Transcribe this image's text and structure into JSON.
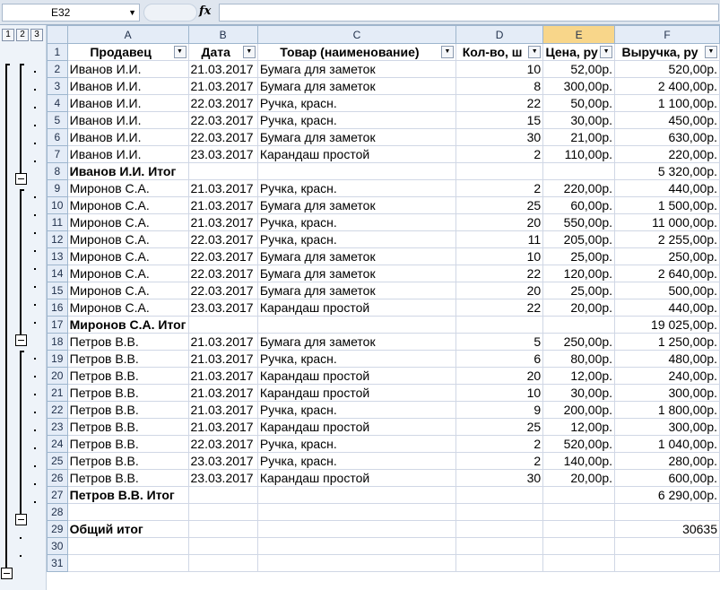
{
  "formula_bar": {
    "name_box": "E32",
    "fx_label": "fx"
  },
  "outline": {
    "levels": [
      "1",
      "2",
      "3"
    ]
  },
  "columns": [
    "A",
    "B",
    "C",
    "D",
    "E",
    "F"
  ],
  "headers": [
    "Продавец",
    "Дата",
    "Товар (наименование)",
    "Кол-во, ш",
    "Цена, ру",
    "Выручка, ру"
  ],
  "rows": [
    {
      "n": "2",
      "a": "Иванов И.И.",
      "b": "21.03.2017",
      "c": "Бумага для заметок",
      "d": "10",
      "e": "52,00р.",
      "f": "520,00р."
    },
    {
      "n": "3",
      "a": "Иванов И.И.",
      "b": "21.03.2017",
      "c": "Бумага для заметок",
      "d": "8",
      "e": "300,00р.",
      "f": "2 400,00р."
    },
    {
      "n": "4",
      "a": "Иванов И.И.",
      "b": "22.03.2017",
      "c": "Ручка, красн.",
      "d": "22",
      "e": "50,00р.",
      "f": "1 100,00р."
    },
    {
      "n": "5",
      "a": "Иванов И.И.",
      "b": "22.03.2017",
      "c": "Ручка, красн.",
      "d": "15",
      "e": "30,00р.",
      "f": "450,00р."
    },
    {
      "n": "6",
      "a": "Иванов И.И.",
      "b": "22.03.2017",
      "c": "Бумага для заметок",
      "d": "30",
      "e": "21,00р.",
      "f": "630,00р."
    },
    {
      "n": "7",
      "a": "Иванов И.И.",
      "b": "23.03.2017",
      "c": "Карандаш простой",
      "d": "2",
      "e": "110,00р.",
      "f": "220,00р."
    },
    {
      "n": "8",
      "a": "Иванов И.И. Итог",
      "b": "",
      "c": "",
      "d": "",
      "e": "",
      "f": "5 320,00р.",
      "total": true
    },
    {
      "n": "9",
      "a": "Миронов С.А.",
      "b": "21.03.2017",
      "c": "Ручка, красн.",
      "d": "2",
      "e": "220,00р.",
      "f": "440,00р."
    },
    {
      "n": "10",
      "a": "Миронов С.А.",
      "b": "21.03.2017",
      "c": "Бумага для заметок",
      "d": "25",
      "e": "60,00р.",
      "f": "1 500,00р."
    },
    {
      "n": "11",
      "a": "Миронов С.А.",
      "b": "21.03.2017",
      "c": "Ручка, красн.",
      "d": "20",
      "e": "550,00р.",
      "f": "11 000,00р."
    },
    {
      "n": "12",
      "a": "Миронов С.А.",
      "b": "22.03.2017",
      "c": "Ручка, красн.",
      "d": "11",
      "e": "205,00р.",
      "f": "2 255,00р."
    },
    {
      "n": "13",
      "a": "Миронов С.А.",
      "b": "22.03.2017",
      "c": "Бумага для заметок",
      "d": "10",
      "e": "25,00р.",
      "f": "250,00р."
    },
    {
      "n": "14",
      "a": "Миронов С.А.",
      "b": "22.03.2017",
      "c": "Бумага для заметок",
      "d": "22",
      "e": "120,00р.",
      "f": "2 640,00р."
    },
    {
      "n": "15",
      "a": "Миронов С.А.",
      "b": "22.03.2017",
      "c": "Бумага для заметок",
      "d": "20",
      "e": "25,00р.",
      "f": "500,00р."
    },
    {
      "n": "16",
      "a": "Миронов С.А.",
      "b": "23.03.2017",
      "c": "Карандаш простой",
      "d": "22",
      "e": "20,00р.",
      "f": "440,00р."
    },
    {
      "n": "17",
      "a": "Миронов С.А. Итог",
      "b": "",
      "c": "",
      "d": "",
      "e": "",
      "f": "19 025,00р.",
      "total": true
    },
    {
      "n": "18",
      "a": "Петров В.В.",
      "b": "21.03.2017",
      "c": "Бумага для заметок",
      "d": "5",
      "e": "250,00р.",
      "f": "1 250,00р."
    },
    {
      "n": "19",
      "a": "Петров В.В.",
      "b": "21.03.2017",
      "c": "Ручка, красн.",
      "d": "6",
      "e": "80,00р.",
      "f": "480,00р."
    },
    {
      "n": "20",
      "a": "Петров В.В.",
      "b": "21.03.2017",
      "c": "Карандаш простой",
      "d": "20",
      "e": "12,00р.",
      "f": "240,00р."
    },
    {
      "n": "21",
      "a": "Петров В.В.",
      "b": "21.03.2017",
      "c": "Карандаш простой",
      "d": "10",
      "e": "30,00р.",
      "f": "300,00р."
    },
    {
      "n": "22",
      "a": "Петров В.В.",
      "b": "21.03.2017",
      "c": "Ручка, красн.",
      "d": "9",
      "e": "200,00р.",
      "f": "1 800,00р."
    },
    {
      "n": "23",
      "a": "Петров В.В.",
      "b": "21.03.2017",
      "c": "Карандаш простой",
      "d": "25",
      "e": "12,00р.",
      "f": "300,00р."
    },
    {
      "n": "24",
      "a": "Петров В.В.",
      "b": "22.03.2017",
      "c": "Ручка, красн.",
      "d": "2",
      "e": "520,00р.",
      "f": "1 040,00р."
    },
    {
      "n": "25",
      "a": "Петров В.В.",
      "b": "23.03.2017",
      "c": "Ручка, красн.",
      "d": "2",
      "e": "140,00р.",
      "f": "280,00р."
    },
    {
      "n": "26",
      "a": "Петров В.В.",
      "b": "23.03.2017",
      "c": "Карандаш простой",
      "d": "30",
      "e": "20,00р.",
      "f": "600,00р."
    },
    {
      "n": "27",
      "a": "Петров В.В. Итог",
      "b": "",
      "c": "",
      "d": "",
      "e": "",
      "f": "6 290,00р.",
      "total": true
    },
    {
      "n": "28",
      "a": "",
      "b": "",
      "c": "",
      "d": "",
      "e": "",
      "f": ""
    },
    {
      "n": "29",
      "a": "Общий итог",
      "b": "",
      "c": "",
      "d": "",
      "e": "",
      "f": "30635",
      "total": true
    },
    {
      "n": "30",
      "a": "",
      "b": "",
      "c": "",
      "d": "",
      "e": "",
      "f": ""
    },
    {
      "n": "31",
      "a": "",
      "b": "",
      "c": "",
      "d": "",
      "e": "",
      "f": ""
    }
  ],
  "header_row_number": "1",
  "colors": {
    "header_bg": "#e4ecf7",
    "selected_header": "#f8d68a",
    "grid_line": "#d0d7e5"
  }
}
